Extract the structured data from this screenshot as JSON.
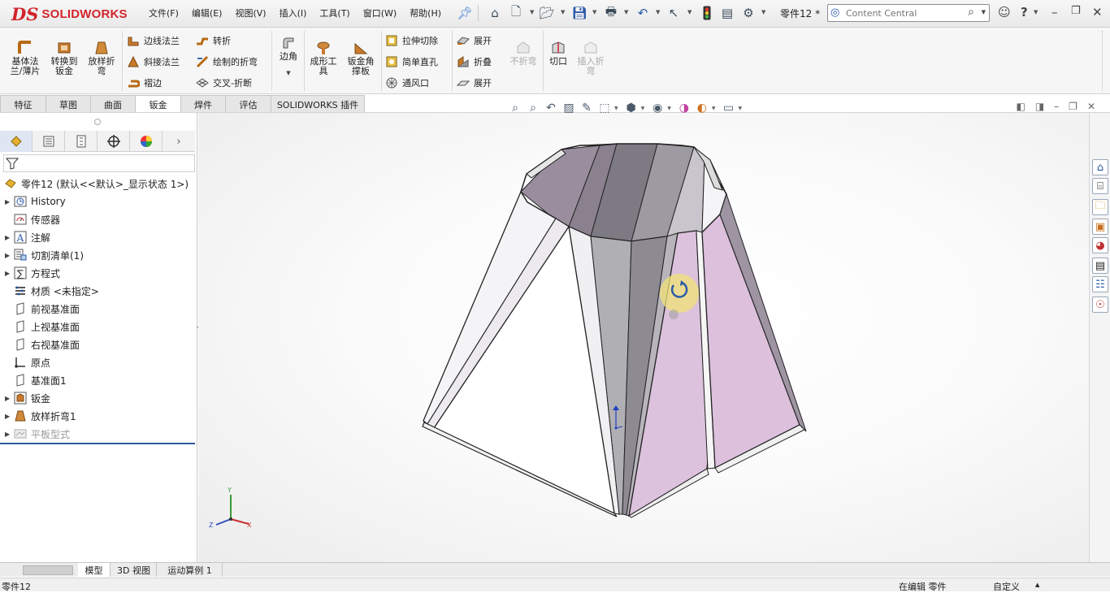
{
  "app": {
    "logo_mark": "DS",
    "logo_text": "SOLIDWORKS"
  },
  "menu": [
    "文件(F)",
    "编辑(E)",
    "视图(V)",
    "插入(I)",
    "工具(T)",
    "窗口(W)",
    "帮助(H)"
  ],
  "document_title": "零件12 *",
  "search": {
    "placeholder": "Content Central"
  },
  "ribbon": {
    "base_flange": "基体法\n兰/薄片",
    "convert_to_sheet": "转换到\n钣金",
    "lofted_bend": "放样折\n弯",
    "edge_flange": "边线法兰",
    "miter_flange": "斜接法兰",
    "hem": "褶边",
    "jog": "转折",
    "sketched_bend": "绘制的折弯",
    "cross_break": "交叉-折断",
    "corners": "边角",
    "forming_tool": "成形工\n具",
    "sheet_gusset": "钣金角\n撑板",
    "extruded_cut": "拉伸切除",
    "simple_hole": "简单直孔",
    "vent": "通风口",
    "unfold": "展开",
    "fold": "折叠",
    "flatten": "展开",
    "no_bends": "不折弯",
    "rip": "切口",
    "insert_bends": "插入折\n弯"
  },
  "command_tabs": [
    "特征",
    "草图",
    "曲面",
    "钣金",
    "焊件",
    "评估",
    "SOLIDWORKS 插件"
  ],
  "active_tab": "钣金",
  "feature_tree": {
    "root": "零件12  (默认<<默认>_显示状态 1>)",
    "items": [
      {
        "label": "History",
        "icon": "history-icon",
        "expandable": true
      },
      {
        "label": "传感器",
        "icon": "sensor-icon",
        "expandable": false
      },
      {
        "label": "注解",
        "icon": "annotation-icon",
        "expandable": true
      },
      {
        "label": "切割清单(1)",
        "icon": "cut-list-icon",
        "expandable": true
      },
      {
        "label": "方程式",
        "icon": "equation-icon",
        "expandable": true
      },
      {
        "label": "材质 <未指定>",
        "icon": "material-icon",
        "expandable": false
      },
      {
        "label": "前视基准面",
        "icon": "plane-icon",
        "expandable": false
      },
      {
        "label": "上视基准面",
        "icon": "plane-icon",
        "expandable": false
      },
      {
        "label": "右视基准面",
        "icon": "plane-icon",
        "expandable": false
      },
      {
        "label": "原点",
        "icon": "origin-icon",
        "expandable": false
      },
      {
        "label": "基准面1",
        "icon": "plane-icon",
        "expandable": false
      },
      {
        "label": "钣金",
        "icon": "sheet-metal-icon",
        "expandable": true
      },
      {
        "label": "放样折弯1",
        "icon": "lofted-bend-icon",
        "expandable": true
      },
      {
        "label": "平板型式",
        "icon": "flat-pattern-icon",
        "expandable": true,
        "suppressed": true
      }
    ]
  },
  "triad": {
    "x": "X",
    "y": "Y",
    "z": "Z"
  },
  "bottom_tabs": [
    "模型",
    "3D 视图",
    "运动算例 1"
  ],
  "status": {
    "left": "零件12",
    "mode": "在编辑 零件",
    "units": "自定义"
  },
  "colors": {
    "accent": "#2c5aa0",
    "brand": "#d2232a",
    "face_pink": "#dcc2dc",
    "face_gray": "#b8b8bc"
  }
}
